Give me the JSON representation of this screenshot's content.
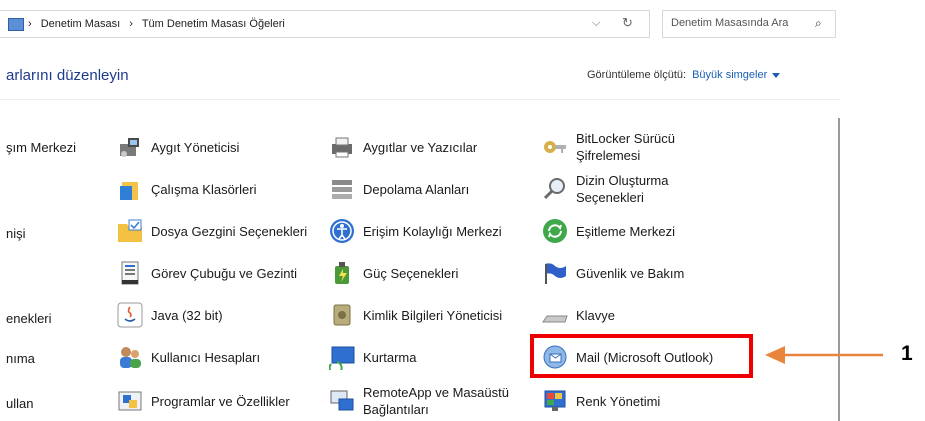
{
  "address_bar": {
    "icon": "control-panel-icon",
    "crumb_1": "Denetim Masası",
    "crumb_2": "Tüm Denetim Masası Öğeleri",
    "separator": "›",
    "dropdown": "⌵",
    "refresh": "↻"
  },
  "search": {
    "placeholder": "Denetim Masasında Ara",
    "icon": "⌕"
  },
  "heading": "arlarını düzenleyin",
  "view_by": {
    "label": "Görüntüleme ölçütü:",
    "value": "Büyük simgeler"
  },
  "cut_labels": [
    "şım Merkezi",
    "nişi",
    "enekleri",
    "nıma",
    "ullan"
  ],
  "items": [
    {
      "label": "Aygıt Yöneticisi",
      "icon": "device-manager-icon"
    },
    {
      "label": "Aygıtlar ve Yazıcılar",
      "icon": "printer-icon"
    },
    {
      "label": "BitLocker Sürücü Şifrelemesi",
      "icon": "bitlocker-key-icon"
    },
    {
      "label": "Çalışma Klasörleri",
      "icon": "work-folders-icon"
    },
    {
      "label": "Depolama Alanları",
      "icon": "storage-spaces-icon"
    },
    {
      "label": "Dizin Oluşturma Seçenekleri",
      "icon": "indexing-magnifier-icon"
    },
    {
      "label": "Dosya Gezgini Seçenekleri",
      "icon": "folder-options-icon"
    },
    {
      "label": "Erişim Kolaylığı Merkezi",
      "icon": "ease-of-access-icon"
    },
    {
      "label": "Eşitleme Merkezi",
      "icon": "sync-center-icon"
    },
    {
      "label": "Görev Çubuğu ve Gezinti",
      "icon": "taskbar-icon"
    },
    {
      "label": "Güç Seçenekleri",
      "icon": "power-options-icon"
    },
    {
      "label": "Güvenlik ve Bakım",
      "icon": "security-flag-icon"
    },
    {
      "label": "Java (32 bit)",
      "icon": "java-icon"
    },
    {
      "label": "Kimlik Bilgileri Yöneticisi",
      "icon": "credential-vault-icon"
    },
    {
      "label": "Klavye",
      "icon": "keyboard-icon"
    },
    {
      "label": "Kullanıcı Hesapları",
      "icon": "user-accounts-icon"
    },
    {
      "label": "Kurtarma",
      "icon": "recovery-icon"
    },
    {
      "label": "Mail (Microsoft Outlook)",
      "icon": "mail-outlook-icon"
    },
    {
      "label": "Programlar ve Özellikler",
      "icon": "programs-features-icon"
    },
    {
      "label": "RemoteApp ve Masaüstü Bağlantıları",
      "icon": "remoteapp-icon"
    },
    {
      "label": "Renk Yönetimi",
      "icon": "color-management-icon"
    }
  ],
  "annotation": {
    "number": "1",
    "highlight_color": "#ee0000",
    "arrow_color": "#e8843c"
  }
}
